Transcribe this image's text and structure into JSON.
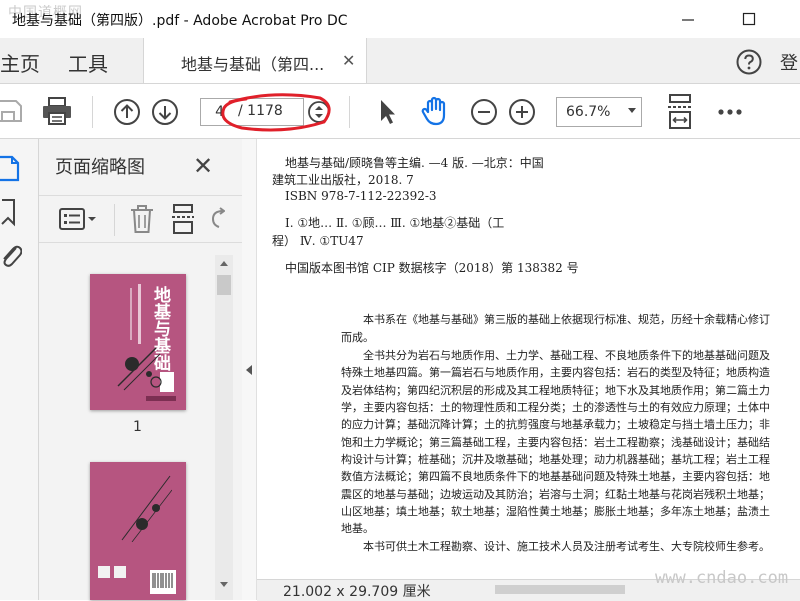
{
  "window": {
    "title": "地基与基础（第四版）.pdf - Adobe Acrobat Pro DC",
    "watermark_top": "中国道概网"
  },
  "tabs": {
    "home": "主页",
    "tools": "工具",
    "document": "地基与基础（第四...",
    "login": "登"
  },
  "toolbar": {
    "page_current": "4",
    "page_total": "/ 1178",
    "zoom": "66.7%"
  },
  "thumbnails": {
    "title": "页面缩略图",
    "cover_title": "地基与基础",
    "page1_label": "1"
  },
  "document": {
    "cip_lines": [
      "地基与基础/顾晓鲁等主编. —4 版. —北京：中国",
      "建筑工业出版社，2018. 7",
      "ISBN 978-7-112-22392-3",
      "Ⅰ. ①地…   Ⅱ. ①顾…   Ⅲ. ①地基②基础（工",
      "程）  Ⅳ. ①TU47",
      "中国版本图书馆 CIP 数据核字（2018）第 138382 号"
    ],
    "body_lines": [
      "本书系在《地基与基础》第三版的基础上依据现行标准、规范，历经十余载精心修订",
      "而成。",
      "全书共分为岩石与地质作用、土力学、基础工程、不良地质条件下的地基基础问题及",
      "特殊土地基四篇。第一篇岩石与地质作用，主要内容包括：岩石的类型及特征；地质构造",
      "及岩体结构；第四纪沉积层的形成及其工程地质特征；地下水及其地质作用；第二篇土力",
      "学，主要内容包括：土的物理性质和工程分类；土的渗透性与土的有效应力原理；土体中",
      "的应力计算；基础沉降计算；土的抗剪强度与地基承载力；土坡稳定与挡土墙土压力；非",
      "饱和土力学概论；第三篇基础工程，主要内容包括：岩土工程勘察；浅基础设计；基础结",
      "构设计与计算；桩基础；沉井及墩基础；地基处理；动力机器基础；基坑工程；岩土工程",
      "数值方法概论；第四篇不良地质条件下的地基基础问题及特殊土地基，主要内容包括：地",
      "震区的地基与基础；边坡运动及其防治；岩溶与土洞；红黏土地基与花岗岩残积土地基；",
      "山区地基；填土地基；软土地基；湿陷性黄土地基；膨胀土地基；多年冻土地基；盐渍土",
      "地基。",
      "本书可供土木工程勘察、设计、施工技术人员及注册考试考生、大专院校师生参考。"
    ]
  },
  "statusbar": {
    "page_size": "21.002 x 29.709 厘米",
    "watermark_bottom": "www.cndao.com"
  },
  "colors": {
    "cover": "#b65580",
    "accent_blue": "#1473e6",
    "annotation_red": "#e0202a"
  }
}
